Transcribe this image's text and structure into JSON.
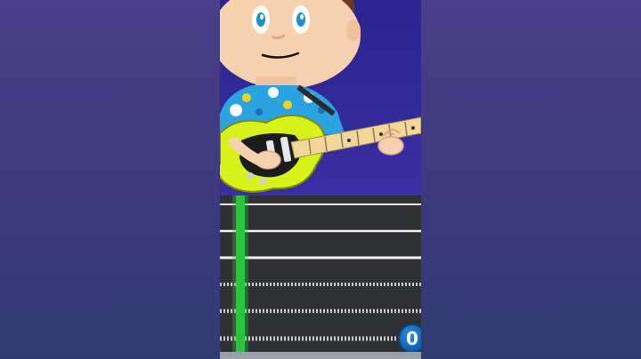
{
  "video": {
    "player": "shorts",
    "scene": "cartoon-boy-playing-electric-guitar",
    "colors": {
      "sky": "#2f27a0",
      "guitar_body": "#d7f21a",
      "shirt": "#2aa3e0",
      "tab_background": "#2f3134",
      "playhead": "#2bc43d",
      "counter_badge": "#0b5fb0"
    }
  },
  "tablature": {
    "string_count": 6,
    "counter": "0"
  }
}
